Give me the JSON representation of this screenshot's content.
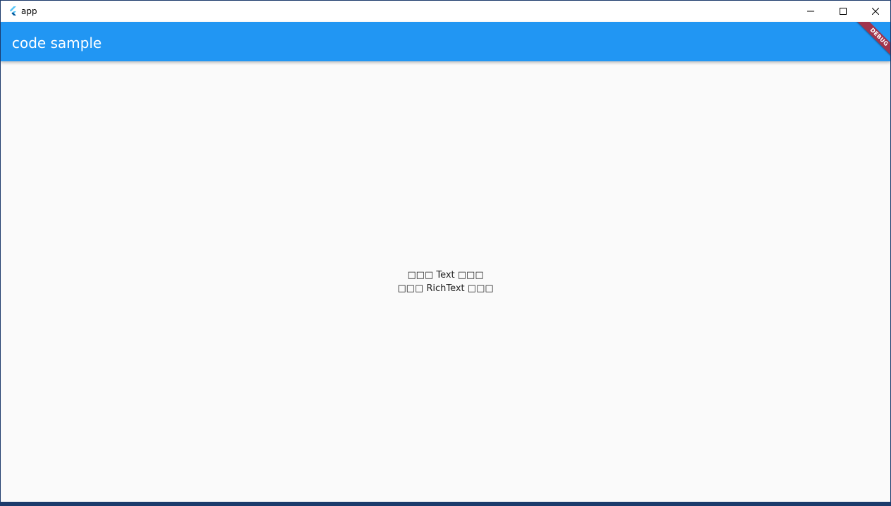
{
  "window": {
    "title": "app"
  },
  "appbar": {
    "title": "code sample"
  },
  "debug_banner": {
    "label": "DEBUG"
  },
  "content": {
    "text_line": "□□□ Text □□□",
    "rich_text_line": "□□□ RichText □□□"
  },
  "colors": {
    "appbar": "#2196f3",
    "debug_banner": "#a0344d",
    "background": "#fafafa"
  },
  "icons": {
    "logo": "flutter-logo-icon",
    "minimize": "minimize-icon",
    "maximize": "maximize-icon",
    "close": "close-icon"
  }
}
